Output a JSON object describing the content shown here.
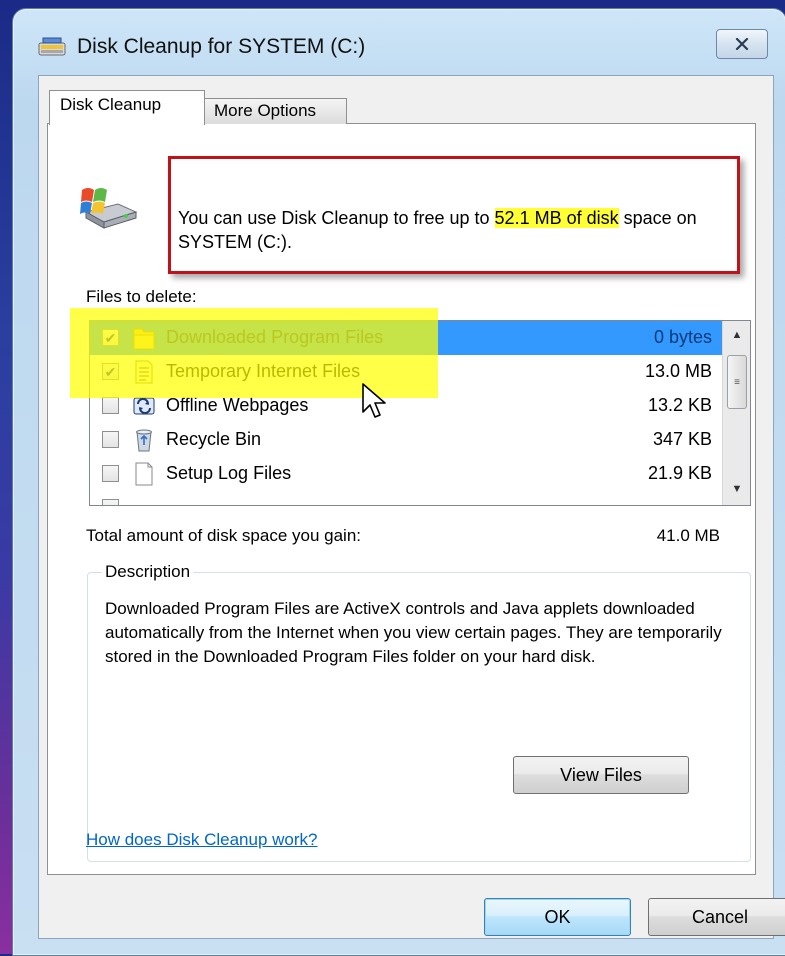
{
  "window": {
    "title": "Disk Cleanup for SYSTEM (C:)",
    "close_icon": "close-icon"
  },
  "tabs": [
    {
      "label": "Disk Cleanup",
      "active": true
    },
    {
      "label": "More Options",
      "active": false
    }
  ],
  "info": {
    "text_before": "You can use Disk Cleanup to free up to ",
    "highlight": "52.1 MB of disk",
    "text_after": " space on SYSTEM (C:)."
  },
  "files": {
    "label": "Files to delete:",
    "items": [
      {
        "name": "Downloaded Program Files",
        "size": "0 bytes",
        "checked": true,
        "selected": true,
        "icon": "folder-icon"
      },
      {
        "name": "Temporary Internet Files",
        "size": "13.0 MB",
        "checked": true,
        "selected": false,
        "icon": "document-icon"
      },
      {
        "name": "Offline Webpages",
        "size": "13.2 KB",
        "checked": false,
        "selected": false,
        "icon": "offline-webpages-icon"
      },
      {
        "name": "Recycle Bin",
        "size": "347 KB",
        "checked": false,
        "selected": false,
        "icon": "recycle-bin-icon"
      },
      {
        "name": "Setup Log Files",
        "size": "21.9 KB",
        "checked": false,
        "selected": false,
        "icon": "file-icon"
      }
    ]
  },
  "total": {
    "label": "Total amount of disk space you gain:",
    "value": "41.0 MB"
  },
  "description": {
    "legend": "Description",
    "text": "Downloaded Program Files are ActiveX controls and Java applets downloaded automatically from the Internet when you view certain pages. They are temporarily stored in the Downloaded Program Files folder on your hard disk."
  },
  "buttons": {
    "view_files": "View Files",
    "ok": "OK",
    "cancel": "Cancel"
  },
  "link": {
    "text": "How does Disk Cleanup work?"
  },
  "colors": {
    "highlight_yellow": "#ffff33",
    "annotation_red": "#c0121a",
    "selection_blue": "#3399ff",
    "link_blue": "#0066cc"
  }
}
